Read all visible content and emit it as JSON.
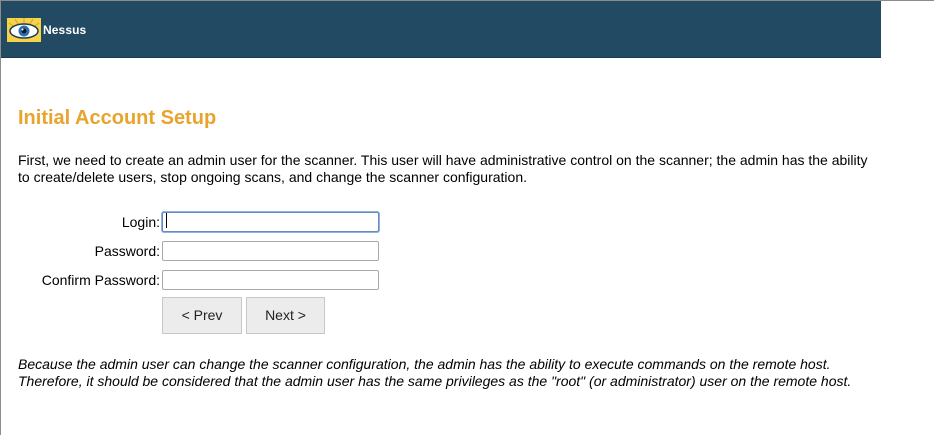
{
  "header": {
    "brand": "Nessus",
    "logo_icon": "nessus-eye-logo-icon",
    "background_color": "#234a63"
  },
  "page": {
    "title": "Initial Account Setup",
    "title_color": "#e8a42c",
    "intro": "First, we need to create an admin user for the scanner. This user will have administrative control on the scanner; the admin has the ability to create/delete users, stop ongoing scans, and change the scanner configuration.",
    "note": "Because the admin user can change the scanner configuration, the admin has the ability to execute commands on the remote host. Therefore, it should be considered that the admin user has the same privileges as the \"root\" (or administrator) user on the remote host."
  },
  "form": {
    "login_label": "Login:",
    "login_value": "",
    "password_label": "Password:",
    "password_value": "",
    "confirm_label": "Confirm Password:",
    "confirm_value": ""
  },
  "buttons": {
    "prev_label": "< Prev",
    "next_label": "Next >"
  }
}
